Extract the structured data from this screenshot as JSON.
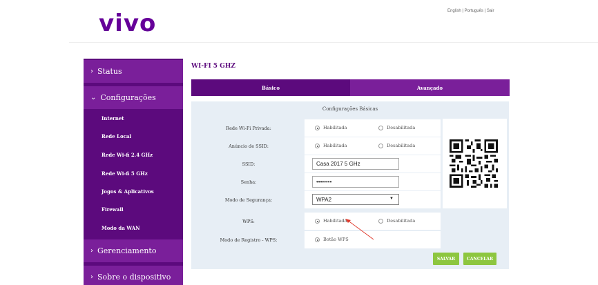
{
  "header": {
    "logo_text": "vivo",
    "lang_links": "English | Português | Sair"
  },
  "sidebar": {
    "sections": {
      "status": "Status",
      "configuracoes": "Configurações",
      "gerenciamento": "Gerenciamento",
      "sobre": "Sobre o dispositivo"
    },
    "items": [
      "Internet",
      "Rede Local",
      "Rede Wi-fi 2.4 GHz",
      "Rede Wi-fi 5 GHz",
      "Jogos & Aplicativos",
      "Firewall",
      "Modo da WAN"
    ]
  },
  "main": {
    "title": "WI-FI 5 GHZ",
    "tabs": [
      "Básico",
      "Avançado"
    ],
    "panel_title": "Configurações Básicas",
    "rows": {
      "rede_privada": {
        "label": "Rede Wi-Fi Privada:",
        "opt1": "Habilitada",
        "opt2": "Desabilitada",
        "selected": "Habilitada"
      },
      "anuncio_ssid": {
        "label": "Anúncio de SSID:",
        "opt1": "Habilitada",
        "opt2": "Desabilitada",
        "selected": "Habilitada"
      },
      "ssid": {
        "label": "SSID:",
        "value": "Casa 2017 5 GHz"
      },
      "senha": {
        "label": "Senha:",
        "value": "••••••••"
      },
      "seguranca": {
        "label": "Modo de Segurança:",
        "value": "WPA2"
      },
      "wps": {
        "label": "WPS:",
        "opt1": "Habilitada",
        "opt2": "Desabilitada",
        "selected": "Habilitada"
      },
      "registro_wps": {
        "label": "Modo de Registro - WPS:",
        "opt1": "Botão WPS",
        "selected": "Botão WPS"
      }
    },
    "buttons": {
      "save": "SALVAR",
      "cancel": "CANCELAR"
    }
  },
  "colors": {
    "brand_purple": "#5c0a7d",
    "tab_purple": "#7a1f9a",
    "button_green": "#8dc63f",
    "panel_bg": "#e7eef5",
    "annotation_arrow": "#e0392b"
  },
  "icons": [
    "qr-code-icon",
    "chevron-right-icon",
    "chevron-down-icon",
    "dropdown-arrow-icon",
    "annotation-arrow"
  ]
}
